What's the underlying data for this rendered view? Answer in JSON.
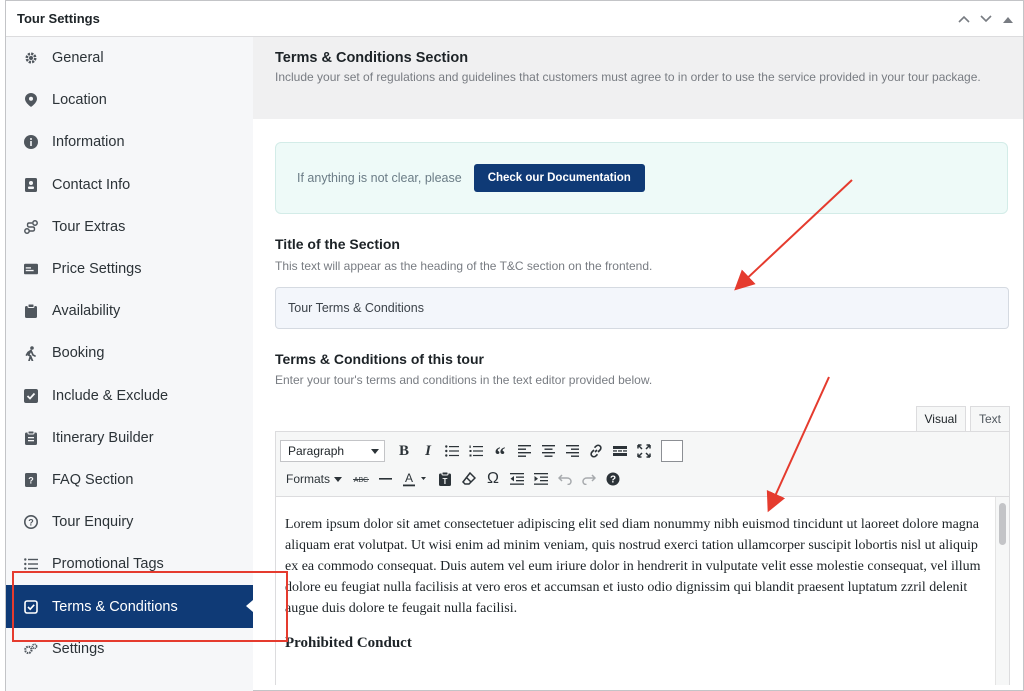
{
  "panel": {
    "title": "Tour Settings"
  },
  "sidebar": {
    "items": [
      {
        "label": "General",
        "icon": "gear-icon"
      },
      {
        "label": "Location",
        "icon": "location-pin-icon"
      },
      {
        "label": "Information",
        "icon": "info-icon"
      },
      {
        "label": "Contact Info",
        "icon": "contact-card-icon"
      },
      {
        "label": "Tour Extras",
        "icon": "extras-icon"
      },
      {
        "label": "Price Settings",
        "icon": "price-card-icon"
      },
      {
        "label": "Availability",
        "icon": "clipboard-icon"
      },
      {
        "label": "Booking",
        "icon": "person-walking-icon"
      },
      {
        "label": "Include & Exclude",
        "icon": "checkbox-icon"
      },
      {
        "label": "Itinerary Builder",
        "icon": "list-clipboard-icon"
      },
      {
        "label": "FAQ Section",
        "icon": "faq-icon"
      },
      {
        "label": "Tour Enquiry",
        "icon": "question-circle-icon"
      },
      {
        "label": "Promotional Tags",
        "icon": "list-icon"
      },
      {
        "label": "Terms & Conditions",
        "icon": "check-square-icon",
        "active": true
      },
      {
        "label": "Settings",
        "icon": "gears-icon"
      }
    ]
  },
  "section": {
    "title": "Terms & Conditions Section",
    "description": "Include your set of regulations and guidelines that customers must agree to in order to use the service provided in your tour package."
  },
  "notice": {
    "text": "If anything is not clear, please",
    "button_label": "Check our Documentation"
  },
  "title_field": {
    "label": "Title of the Section",
    "help": "This text will appear as the heading of the T&C section on the frontend.",
    "value": "Tour Terms & Conditions"
  },
  "terms_field": {
    "label": "Terms & Conditions of this tour",
    "help": "Enter your tour's terms and conditions in the text editor provided below."
  },
  "editor": {
    "tabs": [
      "Visual",
      "Text"
    ],
    "active_tab": "Visual",
    "format_select": "Paragraph",
    "formats_label": "Formats",
    "body_paragraph": "Lorem ipsum dolor sit amet consectetuer adipiscing elit sed diam nonummy nibh euismod tincidunt ut laoreet dolore magna aliquam erat volutpat. Ut wisi enim ad minim veniam, quis nostrud exerci tation ullamcorper suscipit lobortis nisl ut aliquip ex ea commodo consequat. Duis autem vel eum iriure dolor in hendrerit in vulputate velit esse molestie consequat, vel illum dolore eu feugiat nulla facilisis at vero eros et accumsan et iusto odio dignissim qui blandit praesent luptatum zzril delenit augue duis dolore te feugait nulla facilisi.",
    "body_heading": "Prohibited Conduct"
  },
  "colors": {
    "accent": "#0f3a76",
    "annotation": "#e53b2e",
    "notice_bg": "#eefaf8"
  }
}
